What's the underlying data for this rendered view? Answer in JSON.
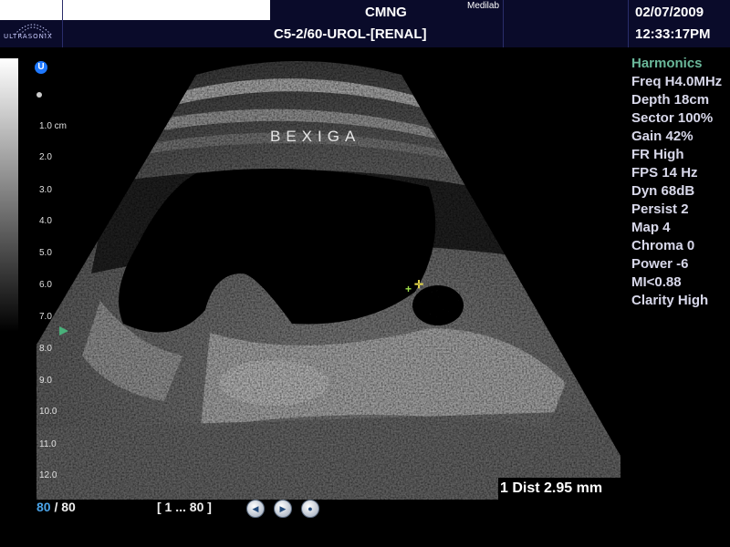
{
  "header": {
    "logo_text": "ULTRASONIX",
    "site": "CMNG",
    "vendor": "Medilab",
    "preset": "C5-2/60-UROL-[RENAL]",
    "date": "02/07/2009",
    "time": "12:33:17PM"
  },
  "left_panel": {
    "mode_icon": "U",
    "depth_labels": [
      "1.0 cm",
      "2.0",
      "3.0",
      "4.0",
      "5.0",
      "6.0",
      "7.0",
      "8.0",
      "9.0",
      "10.0",
      "11.0",
      "12.0"
    ]
  },
  "image": {
    "annotation": "BEXIGA"
  },
  "params": {
    "harmonics": "Harmonics",
    "freq": "Freq H4.0MHz",
    "depth": "Depth 18cm",
    "sector": "Sector 100%",
    "gain": "Gain 42%",
    "fr": "FR High",
    "fps": "FPS 14 Hz",
    "dyn": "Dyn 68dB",
    "persist": "Persist 2",
    "map": "Map 4",
    "chroma": "Chroma 0",
    "power": "Power -6",
    "mi": "MI<0.88",
    "clarity": "Clarity High"
  },
  "measurement": {
    "label": "1  Dist 2.95 mm"
  },
  "cine": {
    "current_frame": "80",
    "separator": "/",
    "total_frames": "80",
    "range": "[ 1 ... 80 ]",
    "buttons": [
      "prev-icon",
      "play-icon",
      "stop-icon"
    ]
  },
  "colors": {
    "header_bg": "#0a0b2a",
    "harmonics": "#6ab89a",
    "frame_accent": "#4aa3e8",
    "caliper": "#9fe04a",
    "marker": "#49b07a"
  }
}
